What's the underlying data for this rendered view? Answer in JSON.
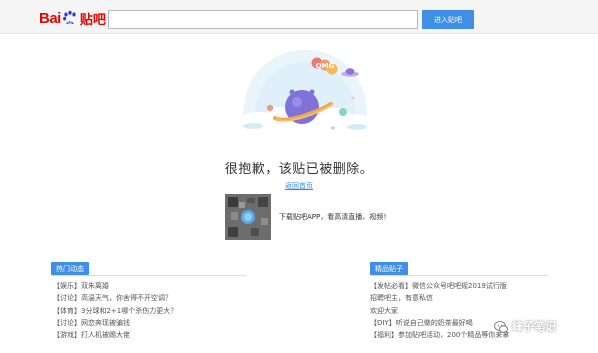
{
  "header": {
    "logo_text_left": "Bai",
    "logo_text_right": "贴吧",
    "search_value": "",
    "enter_button_label": "进入贴吧"
  },
  "main": {
    "illustration_badge": "OMG",
    "message": "很抱歉，该贴已被删除。",
    "back_link": "返回首页",
    "app_promo": "下载贴吧APP，看高清直播、视频！"
  },
  "hot_topics": {
    "title": "热门动态",
    "items": [
      "【娱乐】双朱离婚",
      "【讨论】高温天气，你舍得不开空调？",
      "【体育】3分球和2+1哪个杀伤力更大？",
      "【讨论】网恋奔现被骗钱",
      "【游戏】打人机被踢大佬"
    ]
  },
  "featured_posts": {
    "title": "精品贴子",
    "items": [
      "【发帖必看】微信公众号吧吧规2019试行版",
      "招聘吧主，有意私信",
      "欢迎大家",
      "【DIY】听说自己做的奶茶最好喝",
      "【福利】参加贴吧活动，200个精品等你来拿"
    ]
  },
  "watermark": {
    "text": "峰子笔记"
  },
  "colors": {
    "brand_red": "#e10602",
    "brand_blue": "#2932e1",
    "accent_blue": "#3f8ee8",
    "link_blue": "#3385ff"
  }
}
